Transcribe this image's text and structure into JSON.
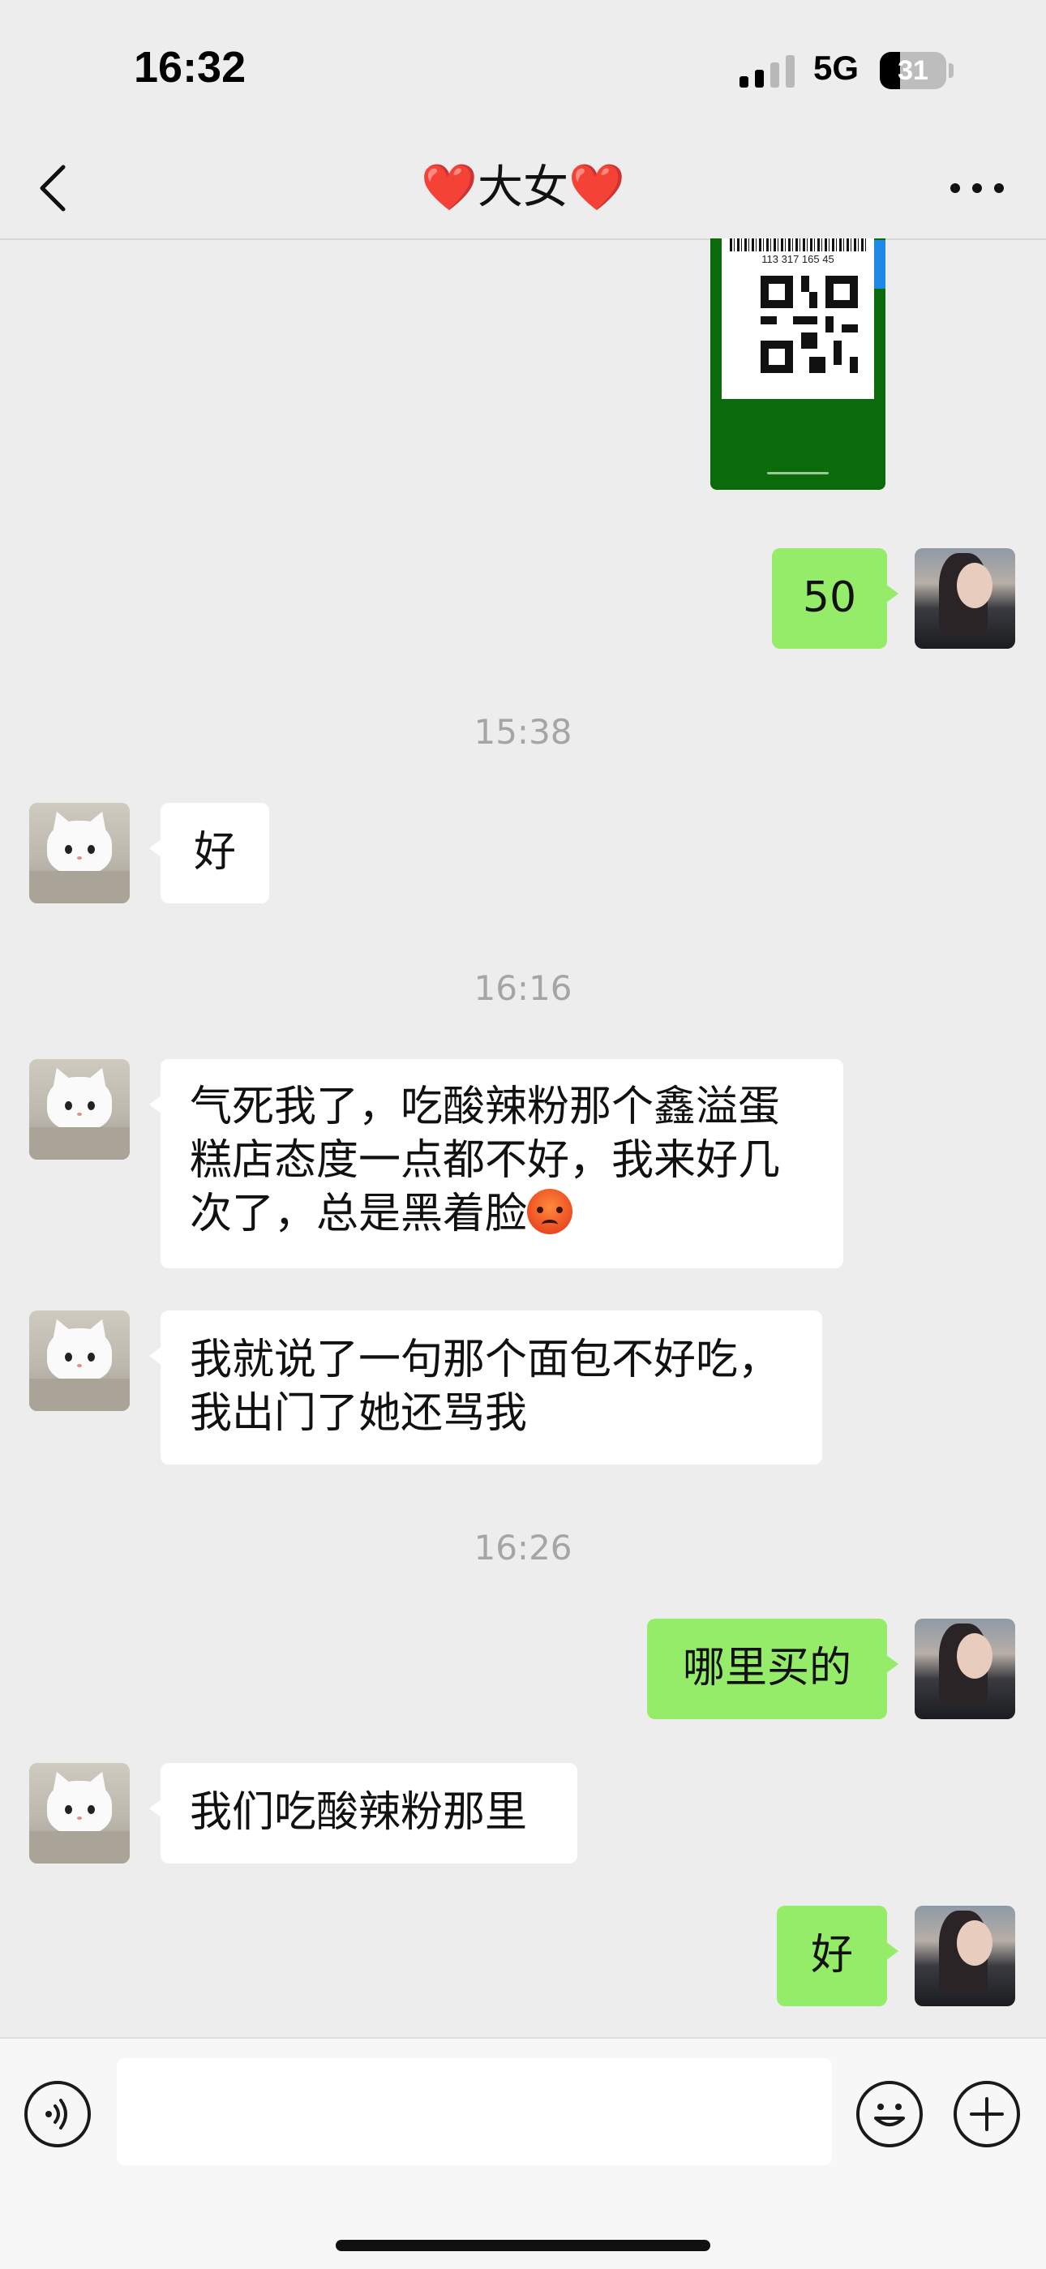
{
  "status_bar": {
    "time": "16:32",
    "network": "5G",
    "battery": "31",
    "battery_level": 0.31
  },
  "header": {
    "title_prefix": "❤️",
    "title": "大女",
    "title_suffix": "❤️",
    "back_icon": "chevron-left-icon",
    "more_icon": "more-dots-icon"
  },
  "image_card": {
    "code": "113 317 165 45"
  },
  "messages": [
    {
      "side": "right",
      "type": "text",
      "text": "50"
    },
    {
      "type": "time",
      "text": "15:38"
    },
    {
      "side": "left",
      "type": "text",
      "text": "好"
    },
    {
      "type": "time",
      "text": "16:16"
    },
    {
      "side": "left",
      "type": "text",
      "text": "气死我了，吃酸辣粉那个鑫溢蛋糕店态度一点都不好，我来好几次了，总是黑着脸",
      "emoji": "angry-face-emoji"
    },
    {
      "side": "left",
      "type": "text",
      "text": "我就说了一句那个面包不好吃，我出门了她还骂我"
    },
    {
      "type": "time",
      "text": "16:26"
    },
    {
      "side": "right",
      "type": "text",
      "text": "哪里买的"
    },
    {
      "side": "left",
      "type": "text",
      "text": "我们吃酸辣粉那里"
    },
    {
      "side": "right",
      "type": "text",
      "text": "好"
    }
  ],
  "input_bar": {
    "voice_icon": "voice-icon",
    "emoji_icon": "emoji-icon",
    "plus_icon": "plus-icon",
    "value": ""
  },
  "colors": {
    "background": "#ededed",
    "my_bubble": "#95ec69",
    "their_bubble": "#ffffff",
    "card": "#0b6b0b"
  }
}
